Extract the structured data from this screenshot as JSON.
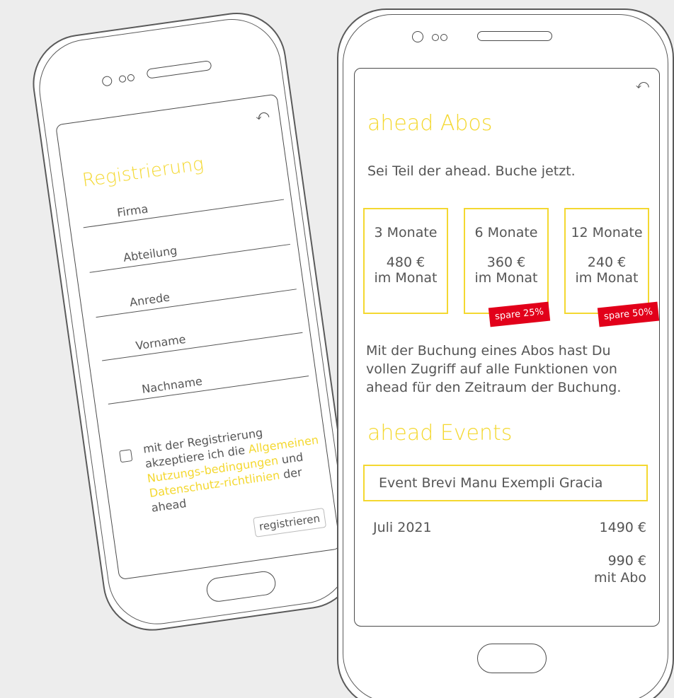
{
  "colors": {
    "accent": "#f4d830",
    "badge": "#e2001a",
    "text": "#555555",
    "background": "#ededed"
  },
  "left_phone": {
    "back_icon": "undo-arrow-icon",
    "title": "Registrierung",
    "fields": [
      "Firma",
      "Abteilung",
      "Anrede",
      "Vorname",
      "Nachname"
    ],
    "consent": {
      "part1": "mit der Registrierung akzeptiere ich die ",
      "link1": "Allgemeinen Nutzungs-bedingungen",
      "part2": " und ",
      "link2": "Datenschutz-richtlinien",
      "part3": " der ahead"
    },
    "register_button": "registrieren"
  },
  "right_phone": {
    "back_icon": "undo-arrow-icon",
    "abos_title": "ahead Abos",
    "subtitle": "Sei Teil der ahead. Buche jetzt.",
    "plans": [
      {
        "duration": "3 Monate",
        "price": "480 €",
        "per": "im Monat",
        "badge": ""
      },
      {
        "duration": "6 Monate",
        "price": "360 €",
        "per": "im Monat",
        "badge": "spare 25%"
      },
      {
        "duration": "12 Monate",
        "price": "240 €",
        "per": "im Monat",
        "badge": "spare 50%"
      }
    ],
    "description": "Mit der Buchung eines Abos hast Du vollen Zugriff auf alle Funktionen von ahead für den Zeitraum der Buchung.",
    "events_title": "ahead Events",
    "event": {
      "name": "Event Brevi Manu Exempli Gracia",
      "date": "Juli 2021",
      "price": "1490 €",
      "abo_price": "990 €",
      "abo_label": "mit Abo"
    }
  }
}
